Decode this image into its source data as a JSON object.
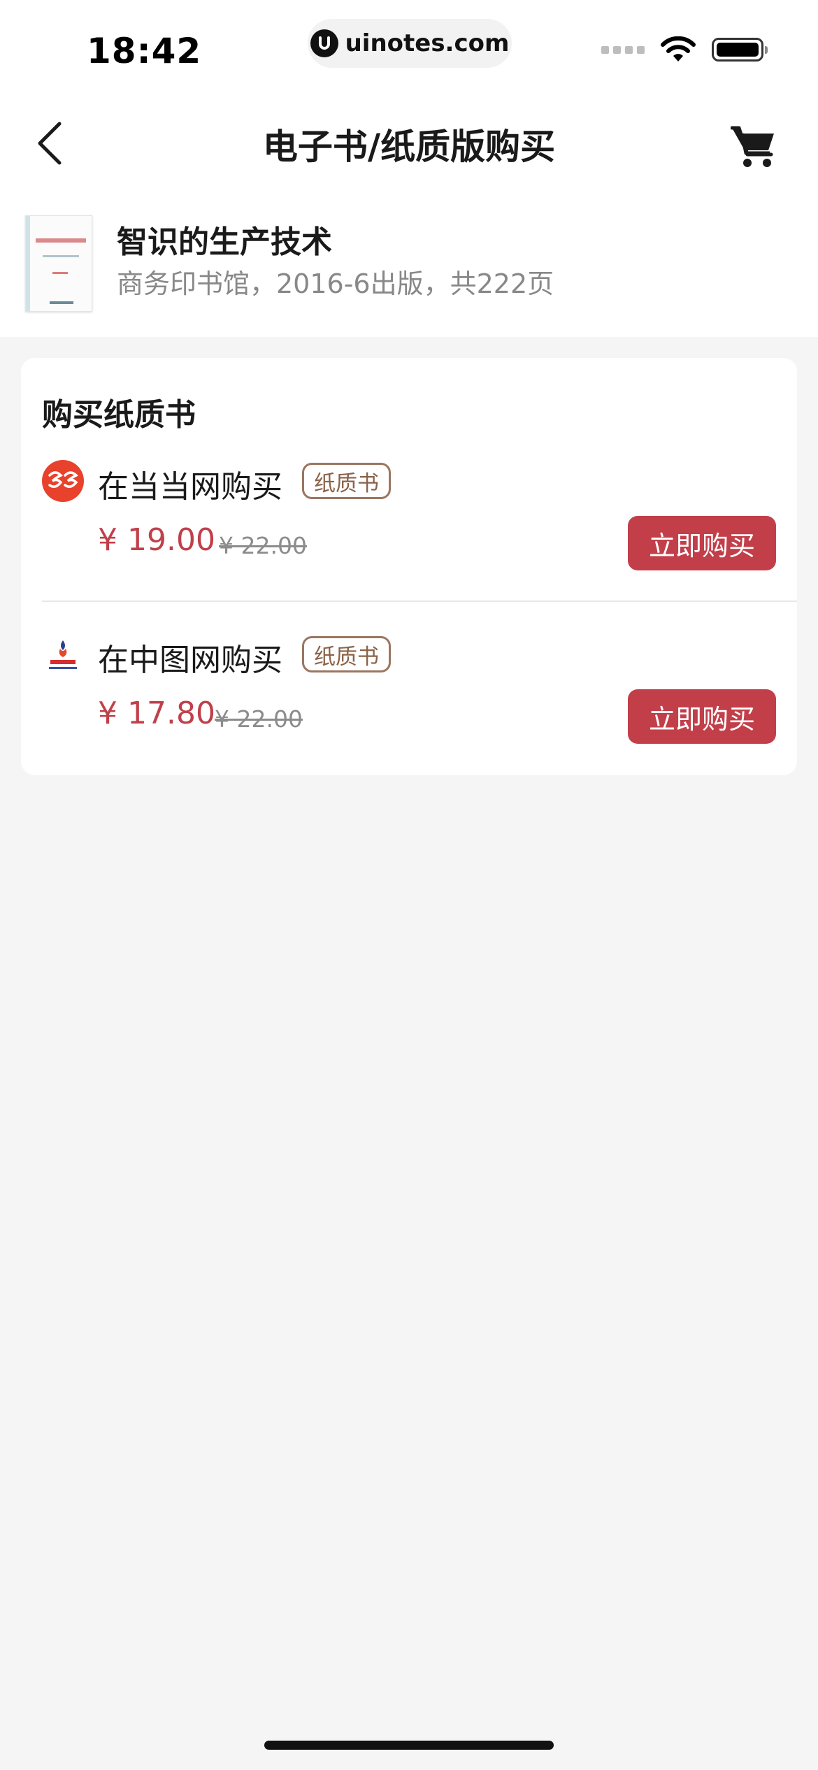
{
  "status_bar": {
    "time": "18:42",
    "url": "uinotes.com"
  },
  "nav": {
    "title": "电子书/纸质版购买",
    "icons": {
      "back": "chevron-left-icon",
      "cart": "shopping-cart-icon"
    }
  },
  "book": {
    "title": "智识的生产技术",
    "meta": "商务印书馆，2016-6出版，共222页"
  },
  "card": {
    "title": "购买纸质书",
    "vendors": [
      {
        "name": "在当当网购买",
        "tag": "纸质书",
        "price": "¥ 19.00",
        "original_price": "¥ 22.00",
        "button": "立即购买",
        "logo_color": "#e8412c"
      },
      {
        "name": "在中图网购买",
        "tag": "纸质书",
        "price": "¥ 17.80",
        "original_price": "¥ 22.00",
        "button": "立即购买",
        "logo_color": "#d62e2e"
      }
    ]
  },
  "colors": {
    "accent": "#c23f4a",
    "price": "#c0404a",
    "tag_border": "#9a7660",
    "background": "#f5f5f5"
  }
}
